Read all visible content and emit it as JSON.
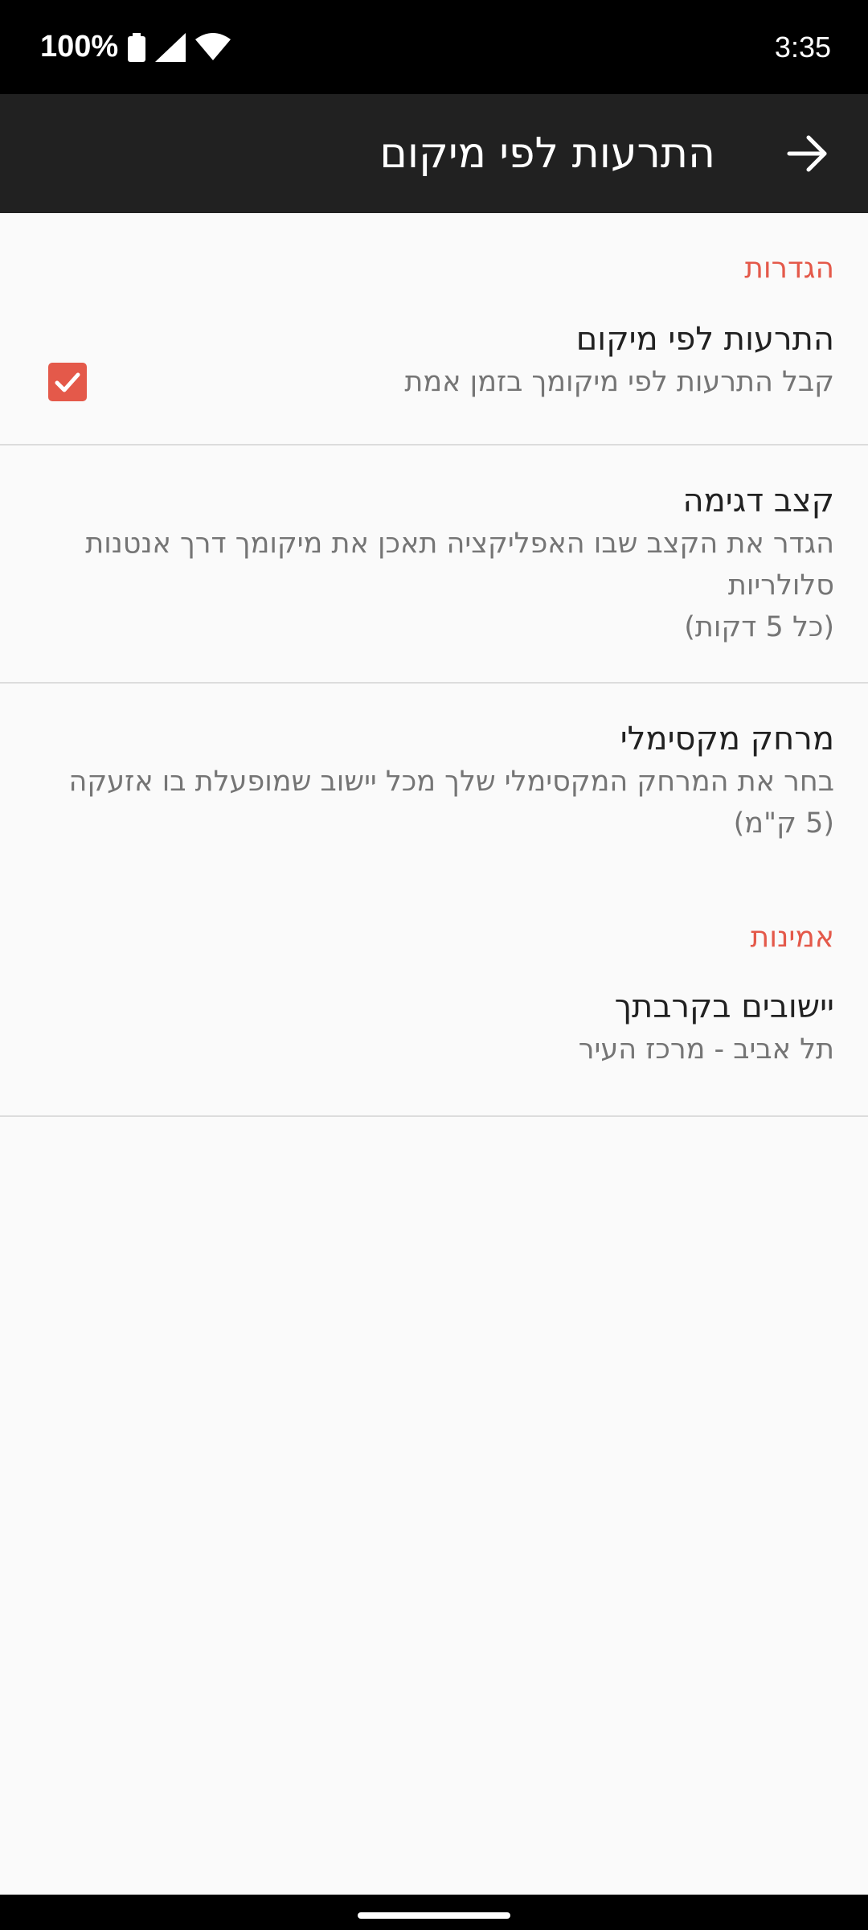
{
  "status_bar": {
    "battery_text": "100%",
    "time": "3:35"
  },
  "app_bar": {
    "title": "התרעות לפי מיקום"
  },
  "settings": {
    "category_label": "הגדרות",
    "location_alerts": {
      "title": "התרעות לפי מיקום",
      "summary": "קבל התרעות לפי מיקומך בזמן אמת",
      "checked": true
    },
    "sampling_rate": {
      "title": "קצב דגימה",
      "summary_line1": "הגדר את הקצב שבו האפליקציה תאכן את מיקומך דרך אנטנות",
      "summary_line2": "סלולריות",
      "summary_line3": "(כל 5 דקות)"
    },
    "max_distance": {
      "title": "מרחק מקסימלי",
      "summary_line1": "בחר את המרחק המקסימלי שלך מכל יישוב שמופעלת בו אזעקה",
      "summary_line2": "(5 ק\"מ)"
    }
  },
  "drills": {
    "category_label": "אמינות",
    "nearby_cities": {
      "title": "יישובים בקרבתך",
      "summary": "תל אביב - מרכז העיר"
    }
  },
  "colors": {
    "accent": "#e4594a",
    "app_bar": "#212121",
    "background": "#fafafa"
  }
}
